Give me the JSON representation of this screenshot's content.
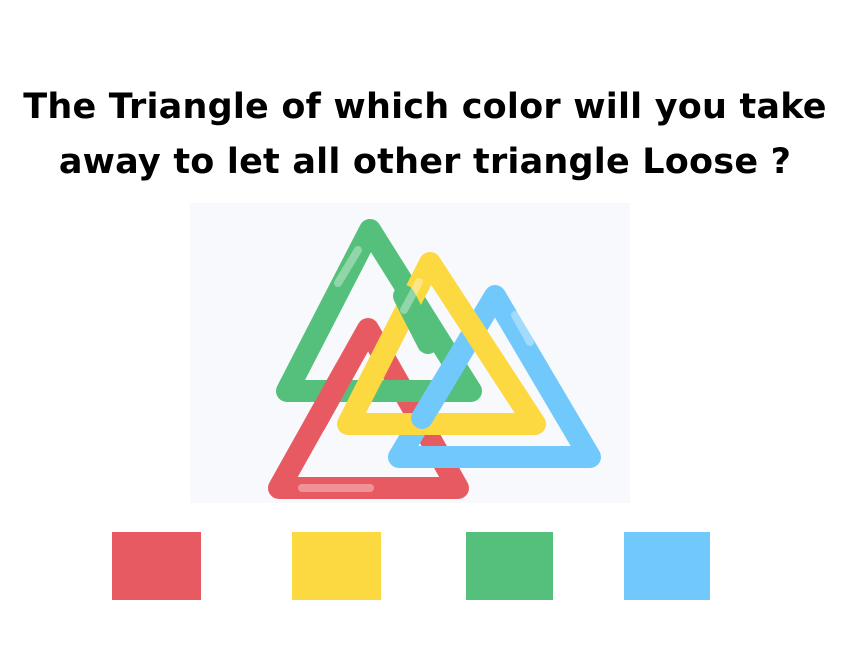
{
  "question": {
    "line1": "The Triangle of which color will you take",
    "line2": "away to let all other triangle Loose ?"
  },
  "puzzle": {
    "background_color": "#f8f9fc",
    "triangles": [
      {
        "color_name": "red",
        "color": "#e85a61"
      },
      {
        "color_name": "green",
        "color": "#55c07c"
      },
      {
        "color_name": "blue",
        "color": "#71c9fb"
      },
      {
        "color_name": "yellow",
        "color": "#fcd841"
      }
    ]
  },
  "options": [
    {
      "id": "red",
      "color": "#e85a61"
    },
    {
      "id": "yellow",
      "color": "#fcd841"
    },
    {
      "id": "green",
      "color": "#55c07c"
    },
    {
      "id": "blue",
      "color": "#71c9fb"
    }
  ]
}
